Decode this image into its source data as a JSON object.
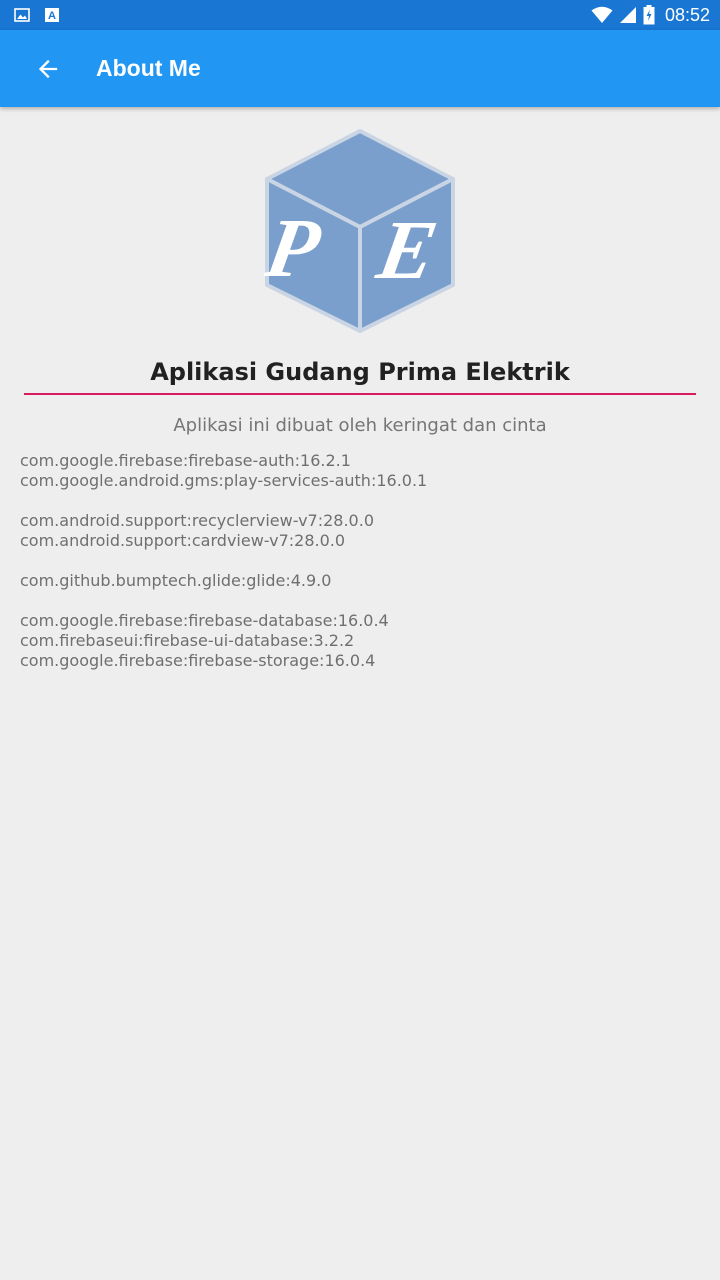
{
  "status_bar": {
    "time": "08:52",
    "icons": [
      "image-icon",
      "font-icon",
      "wifi-icon",
      "signal-icon",
      "battery-icon"
    ]
  },
  "app_bar": {
    "title": "About Me",
    "back_icon": "arrow-back-icon"
  },
  "logo": {
    "letters": [
      "P",
      "E"
    ],
    "color": "#7a9fcd"
  },
  "content": {
    "app_name": "Aplikasi Gudang Prima Elektrik",
    "tagline": "Aplikasi ini dibuat oleh keringat dan cinta",
    "library_groups": [
      [
        "com.google.firebase:firebase-auth:16.2.1",
        "com.google.android.gms:play-services-auth:16.0.1"
      ],
      [
        "com.android.support:recyclerview-v7:28.0.0",
        "com.android.support:cardview-v7:28.0.0"
      ],
      [
        "com.github.bumptech.glide:glide:4.9.0"
      ],
      [
        "com.google.firebase:firebase-database:16.0.4",
        "com.firebaseui:firebase-ui-database:3.2.2",
        "com.google.firebase:firebase-storage:16.0.4"
      ]
    ]
  },
  "colors": {
    "status_bar": "#1976d2",
    "app_bar": "#2196f3",
    "divider": "#d81b60",
    "background": "#eeeeee"
  }
}
